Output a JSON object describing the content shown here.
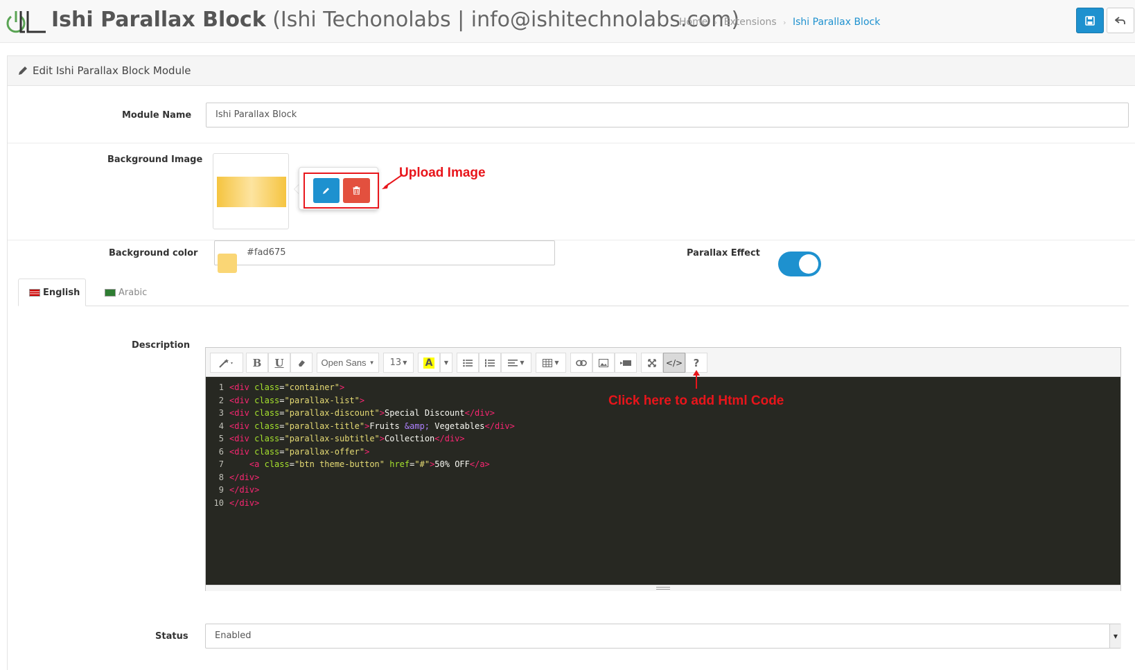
{
  "header": {
    "title": "Ishi Parallax Block",
    "subtitle": "(Ishi Techonolabs | info@ishitechnolabs.com)",
    "breadcrumb": [
      "Home",
      "Extensions",
      "Ishi Parallax Block"
    ]
  },
  "panel": {
    "heading": "Edit Ishi Parallax Block Module"
  },
  "form": {
    "module_name_label": "Module Name",
    "module_name_value": "Ishi Parallax Block",
    "background_image_label": "Background Image",
    "background_color_label": "Background color",
    "background_color_value": "#fad675",
    "parallax_effect_label": "Parallax Effect",
    "parallax_effect_on": true,
    "description_label": "Description",
    "status_label": "Status",
    "status_value": "Enabled"
  },
  "tabs": [
    {
      "label": "English",
      "active": true
    },
    {
      "label": "Arabic",
      "active": false
    }
  ],
  "toolbar": {
    "font_family": "Open Sans",
    "font_size": "13",
    "color_letter": "A",
    "bold": "B",
    "underline": "U",
    "help": "?"
  },
  "annotations": {
    "upload_image": "Upload Image",
    "click_html": "Click here to add Html Code"
  },
  "code_lines": [
    "<div class=\"container\">",
    "<div class=\"parallax-list\">",
    "<div class=\"parallax-discount\">Special Discount</div>",
    "<div class=\"parallax-title\">Fruits &amp; Vegetables</div>",
    "<div class=\"parallax-subtitle\">Collection</div>",
    "<div class=\"parallax-offer\">",
    "    <a class=\"btn theme-button\" href=\"#\">50% OFF</a>",
    "</div>",
    "</div>",
    "</div>"
  ],
  "colors": {
    "primary": "#1e91cf",
    "danger": "#e3503e",
    "annotation": "#e8151b",
    "swatch": "#fad675"
  }
}
